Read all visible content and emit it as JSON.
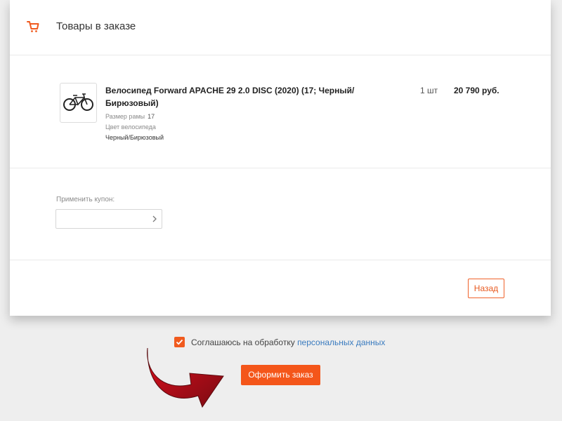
{
  "header": {
    "title": "Товары в заказе",
    "icon": "cart-icon"
  },
  "product": {
    "name": "Велосипед Forward APACHE 29 2.0 DISC (2020) (17; Черный/ Бирюзовый)",
    "props": [
      {
        "label": "Размер рамы",
        "value": "17"
      },
      {
        "label": "Цвет велосипеда",
        "value": "Черный/Бирюзовый"
      }
    ],
    "quantity": "1 шт",
    "price": "20 790 руб."
  },
  "coupon": {
    "label": "Применить купон:",
    "value": ""
  },
  "buttons": {
    "back": "Назад",
    "submit": "Оформить заказ"
  },
  "agreement": {
    "checked": true,
    "text": "Соглашаюсь на обработку",
    "link": "персональных данных"
  },
  "colors": {
    "accent": "#f4561a",
    "link": "#3a7bbf",
    "arrow": "#c8102e"
  }
}
